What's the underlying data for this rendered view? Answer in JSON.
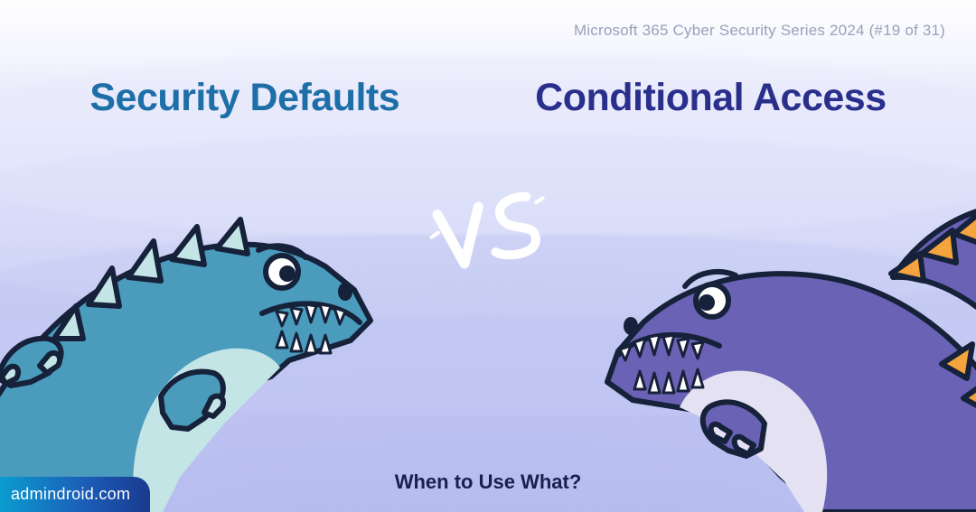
{
  "series_label": "Microsoft 365 Cyber Security Series 2024 (#19 of 31)",
  "title_left": "Security Defaults",
  "title_right": "Conditional Access",
  "vs_label": "VS",
  "subtitle": "When to Use What?",
  "brand": "admindroid.com",
  "colors": {
    "title_left": "#1e6fa8",
    "title_right": "#2a2f8c",
    "dino_left_body": "#4a9bbc",
    "dino_left_belly": "#c3e5e6",
    "dino_right_body": "#6a62b5",
    "dino_right_belly": "#e4e1f3",
    "dino_right_spikes": "#f5a33d",
    "outline": "#16213a"
  }
}
